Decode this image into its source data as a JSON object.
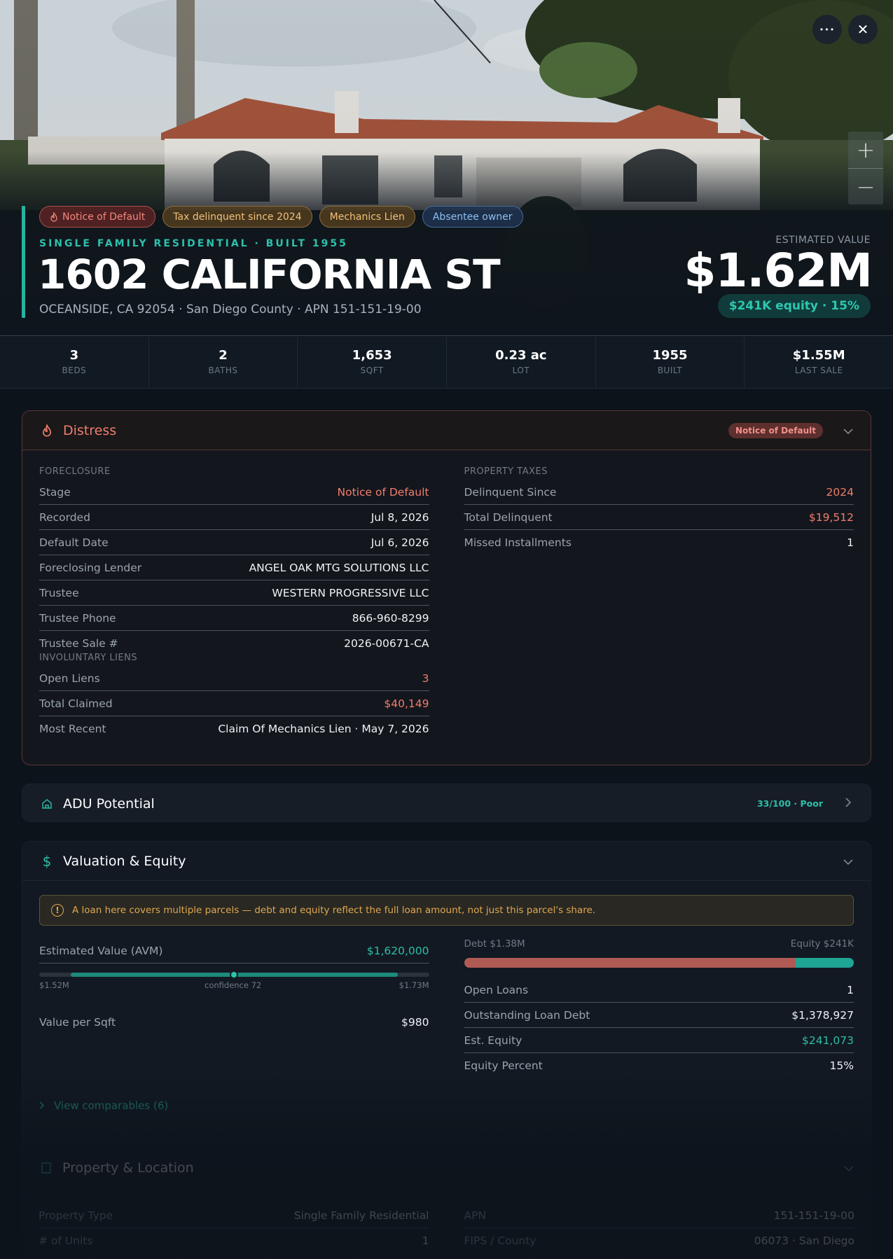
{
  "header": {
    "more_icon": "more-horizontal-icon",
    "close_icon": "close-icon",
    "zoom_in_icon": "plus-icon",
    "zoom_out_icon": "minus-icon",
    "zoom_in": "+",
    "zoom_out": "−",
    "more": "•••",
    "close": "✕"
  },
  "tags": [
    {
      "label": "Notice of Default",
      "tone": "red",
      "icon": "flame-icon"
    },
    {
      "label": "Tax delinquent since 2024",
      "tone": "amber"
    },
    {
      "label": "Mechanics Lien",
      "tone": "amber"
    },
    {
      "label": "Absentee owner",
      "tone": "blue"
    }
  ],
  "property": {
    "subtitle": "SINGLE FAMILY RESIDENTIAL · BUILT 1955",
    "address": "1602 CALIFORNIA ST",
    "location": "OCEANSIDE, CA 92054 · San Diego County · APN 151-151-19-00",
    "estimated_value_label": "ESTIMATED VALUE",
    "estimated_value": "$1.62M",
    "equity_pill": "$241K equity · 15%"
  },
  "stats": [
    {
      "value": "3",
      "label": "BEDS"
    },
    {
      "value": "2",
      "label": "BATHS"
    },
    {
      "value": "1,653",
      "label": "SQFT"
    },
    {
      "value": "0.23 ac",
      "label": "LOT"
    },
    {
      "value": "1955",
      "label": "BUILT"
    },
    {
      "value": "$1.55M",
      "label": "LAST SALE"
    }
  ],
  "distress": {
    "title": "Distress",
    "badge": "Notice of Default",
    "foreclosure": {
      "heading": "FORECLOSURE",
      "rows": [
        {
          "k": "Stage",
          "v": "Notice of Default",
          "tone": "red"
        },
        {
          "k": "Recorded",
          "v": "Jul 8, 2026"
        },
        {
          "k": "Default Date",
          "v": "Jul 6, 2026"
        },
        {
          "k": "Foreclosing Lender",
          "v": "ANGEL OAK MTG SOLUTIONS LLC"
        },
        {
          "k": "Trustee",
          "v": "WESTERN PROGRESSIVE LLC"
        },
        {
          "k": "Trustee Phone",
          "v": "866-960-8299"
        },
        {
          "k": "Trustee Sale #",
          "v": "2026-00671-CA"
        }
      ]
    },
    "liens": {
      "heading": "INVOLUNTARY LIENS",
      "rows": [
        {
          "k": "Open Liens",
          "v": "3",
          "tone": "red"
        },
        {
          "k": "Total Claimed",
          "v": "$40,149",
          "tone": "red"
        },
        {
          "k": "Most Recent",
          "v": "Claim Of Mechanics Lien · May 7, 2026"
        }
      ]
    },
    "taxes": {
      "heading": "PROPERTY TAXES",
      "rows": [
        {
          "k": "Delinquent Since",
          "v": "2024",
          "tone": "red"
        },
        {
          "k": "Total Delinquent",
          "v": "$19,512",
          "tone": "red"
        },
        {
          "k": "Missed Installments",
          "v": "1"
        }
      ]
    }
  },
  "adu": {
    "title": "ADU Potential",
    "score": "33/100 · Poor"
  },
  "valuation": {
    "title": "Valuation & Equity",
    "note": "A loan here covers multiple parcels — debt and equity reflect the full loan amount, not just this parcel's share.",
    "avm_label": "Estimated Value (AVM)",
    "avm_value": "$1,620,000",
    "range_low": "$1.52M",
    "range_mid": "confidence 72",
    "range_high": "$1.73M",
    "avm_position": 0.5,
    "vpsf_label": "Value per Sqft",
    "vpsf_value": "$980",
    "debt_label": "Debt $1.38M",
    "equity_label": "Equity $241K",
    "debt_fraction": 0.85,
    "rows": [
      {
        "k": "Open Loans",
        "v": "1"
      },
      {
        "k": "Outstanding Loan Debt",
        "v": "$1,378,927"
      },
      {
        "k": "Est. Equity",
        "v": "$241,073",
        "tone": "green"
      },
      {
        "k": "Equity Percent",
        "v": "15%"
      }
    ],
    "comparables": "View comparables (6)"
  },
  "property_location": {
    "title": "Property & Location",
    "left": [
      {
        "k": "Property Type",
        "v": "Single Family Residential"
      },
      {
        "k": "# of Units",
        "v": "1"
      }
    ],
    "right": [
      {
        "k": "APN",
        "v": "151-151-19-00"
      },
      {
        "k": "FIPS / County",
        "v": "06073 · San Diego"
      }
    ]
  },
  "colors": {
    "accent": "#26b3a0",
    "distress": "#f07d6c",
    "amber": "#e0a851",
    "debt": "#b05a55"
  }
}
